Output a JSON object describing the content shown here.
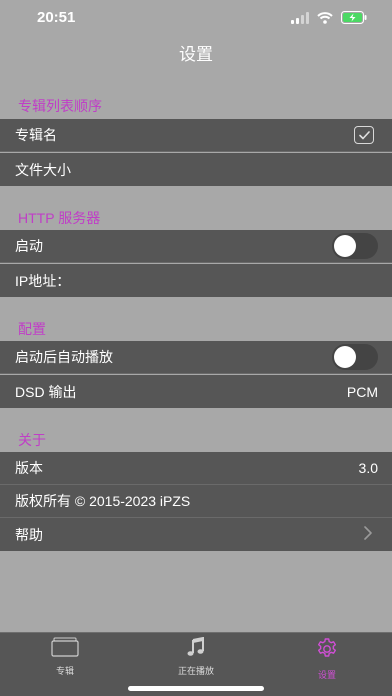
{
  "status_bar": {
    "time": "20:51",
    "icons": [
      "cellular-icon",
      "wifi-icon",
      "battery-charging-icon"
    ]
  },
  "nav": {
    "title": "设置"
  },
  "sections": {
    "album_order": {
      "header": "专辑列表顺序",
      "rows": [
        {
          "label": "专辑名",
          "control": "checkbox",
          "checked": true
        },
        {
          "label": "文件大小"
        }
      ]
    },
    "http_server": {
      "header": "HTTP 服务器",
      "rows": [
        {
          "label": "启动",
          "control": "toggle",
          "on": false
        },
        {
          "label": "IP地址："
        }
      ]
    },
    "config": {
      "header": "配置",
      "rows": [
        {
          "label": "启动后自动播放",
          "control": "toggle",
          "on": false
        },
        {
          "label": "DSD 输出",
          "value": "PCM"
        }
      ]
    },
    "about": {
      "header": "关于",
      "rows": [
        {
          "label": "版本",
          "value": "3.0"
        },
        {
          "label": "版权所有 © 2015-2023  iPZS"
        },
        {
          "label": "帮助",
          "control": "chevron"
        }
      ]
    }
  },
  "tabbar": {
    "tabs": [
      {
        "label": "专辑",
        "icon": "album-icon",
        "active": false
      },
      {
        "label": "正在播放",
        "icon": "music-note-icon",
        "active": false
      },
      {
        "label": "设置",
        "icon": "gear-icon",
        "active": true
      }
    ]
  },
  "colors": {
    "background": "#a8a8a8",
    "row": "#565656",
    "accent": "#c03ec7",
    "battery": "#4cd964"
  }
}
